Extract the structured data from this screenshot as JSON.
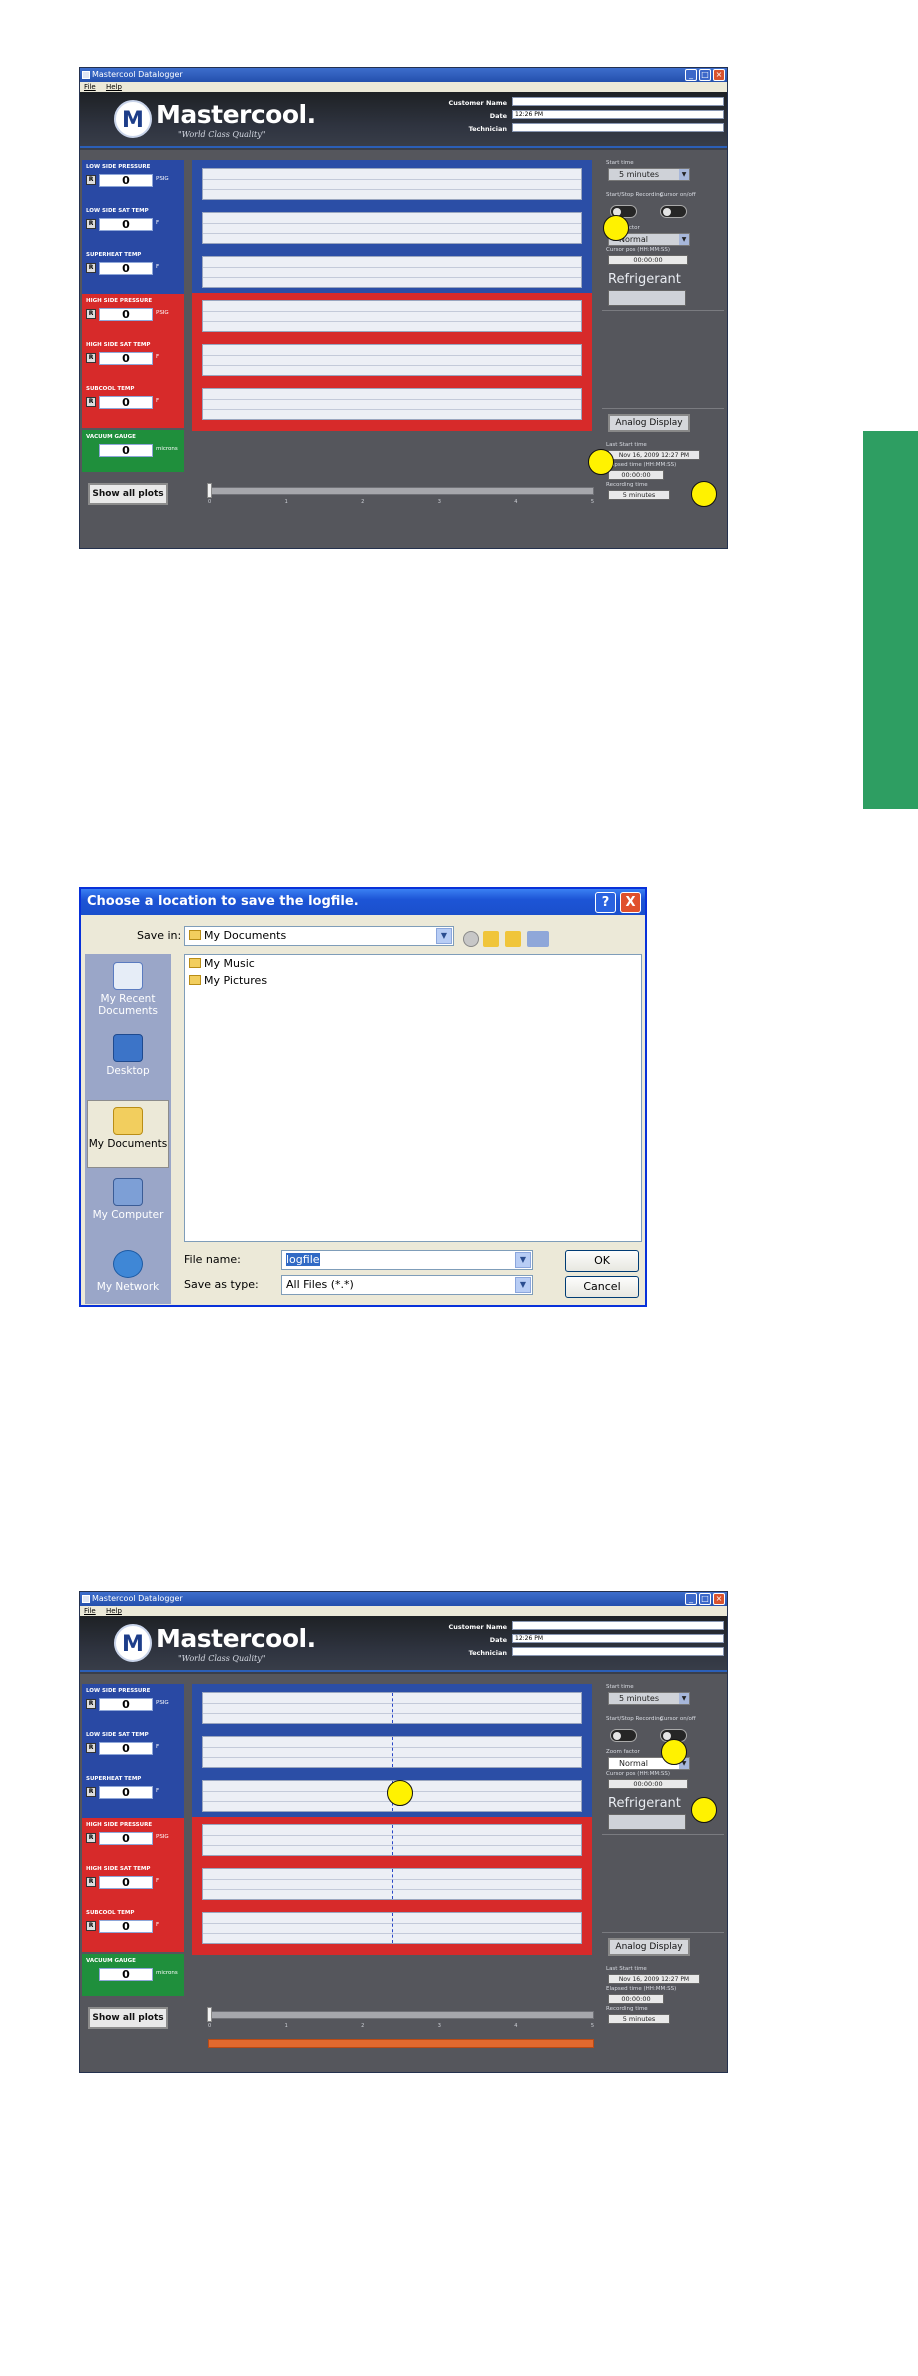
{
  "window": {
    "title": "Mastercool Datalogger",
    "menu": [
      "File",
      "Help"
    ]
  },
  "header": {
    "logo_mark": "M",
    "logo_text": "Mastercool.",
    "tagline": "\"World Class Quality\"",
    "customer_name_label": "Customer Name",
    "date_label": "Date",
    "technician_label": "Technician",
    "customer_name_value": "",
    "date_value": "12:26 PM",
    "technician_value": ""
  },
  "gauges": [
    {
      "label": "LOW SIDE PRESSURE",
      "value": "0",
      "unit": "PSIG",
      "btn": "R"
    },
    {
      "label": "LOW SIDE SAT TEMP",
      "value": "0",
      "unit": "F",
      "btn": "R"
    },
    {
      "label": "SUPERHEAT TEMP",
      "value": "0",
      "unit": "F",
      "btn": "R"
    },
    {
      "label": "HIGH SIDE PRESSURE",
      "value": "0",
      "unit": "PSIG",
      "btn": "R"
    },
    {
      "label": "HIGH SIDE SAT TEMP",
      "value": "0",
      "unit": "F",
      "btn": "R"
    },
    {
      "label": "SUBCOOL TEMP",
      "value": "0",
      "unit": "F",
      "btn": "R"
    },
    {
      "label": "VACUUM GAUGE",
      "value": "0",
      "unit": "microns",
      "btn": ""
    }
  ],
  "controls": {
    "show_all_plots": "Show all plots",
    "start_time_label": "Start time",
    "start_time_value": "5 minutes",
    "start_stop_label": "Start/Stop Recording",
    "cursor_label": "Cursor on/off",
    "zoom_label": "Zoom factor",
    "zoom_value": "Normal",
    "cursor_pos_label": "Cursor pos (HH:MM:SS)",
    "cursor_pos_value": "00:00:00",
    "refrigerant_label": "Refrigerant",
    "refrigerant_value": "",
    "analog_display": "Analog Display",
    "last_start_label": "Last Start time",
    "last_start_value": "Nov 16, 2009 12:27 PM",
    "elapsed_label": "Elapsed time (HH:MM:SS)",
    "elapsed_value": "00:00:00",
    "recording_label": "Recording time",
    "recording_value": "5 minutes",
    "ticks": [
      "0",
      "1",
      "2",
      "3",
      "4",
      "5"
    ]
  },
  "dialog": {
    "title": "Choose a location to save the logfile.",
    "help_btn": "?",
    "close_btn": "X",
    "save_in_label": "Save in:",
    "save_in_value": "My Documents",
    "places": [
      "My Recent Documents",
      "Desktop",
      "My Documents",
      "My Computer",
      "My Network"
    ],
    "files": [
      "My Music",
      "My Pictures"
    ],
    "file_name_label": "File name:",
    "file_name_value": "logfile",
    "save_as_label": "Save as type:",
    "save_as_value": "All Files (*.*)",
    "ok": "OK",
    "cancel": "Cancel"
  },
  "colors": {
    "side_tab": "#2e9e62",
    "marker": "#fff200",
    "blue_panel": "#2949a4",
    "red_panel": "#d72a2a",
    "green_panel": "#1f8f3c",
    "orange_bar": "#e2692e"
  },
  "icons": [
    "app-icon",
    "minimize-icon",
    "maximize-icon",
    "close-icon",
    "logo-icon",
    "toggle-switch-icon",
    "dropdown-arrow-icon",
    "folder-icon",
    "back-icon",
    "up-folder-icon",
    "new-folder-icon",
    "views-icon",
    "recent-documents-icon",
    "desktop-icon",
    "my-documents-icon",
    "my-computer-icon",
    "my-network-icon"
  ]
}
